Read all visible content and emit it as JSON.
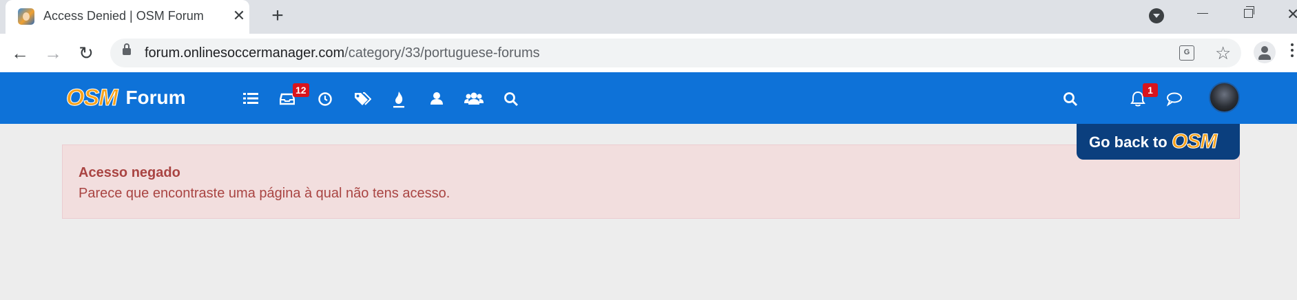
{
  "browser": {
    "tab": {
      "title": "Access Denied | OSM Forum",
      "close_glyph": "✕",
      "favicon": "osm-favicon-icon"
    },
    "new_tab_glyph": "+",
    "window_close_glyph": "✕",
    "address_bar": {
      "host": "forum.onlinesoccermanager.com",
      "path": "/category/33/portuguese-forums"
    },
    "nav": {
      "back_glyph": "←",
      "forward_glyph": "→",
      "reload_glyph": "↻"
    },
    "star_glyph": "☆",
    "translate_glyph": "G"
  },
  "forum": {
    "logo": {
      "brand": "OSM",
      "name": "Forum"
    },
    "nav_icons": [
      "list-icon",
      "inbox-icon",
      "clock-icon",
      "tags-icon",
      "fire-icon",
      "user-icon",
      "users-icon",
      "search-icon"
    ],
    "unread_badge": "12",
    "notification_badge": "1",
    "colors": {
      "header": "#0e72d8",
      "badge": "#d9141c",
      "alert_bg": "#f2dede",
      "alert_text": "#a94442",
      "go_back_bg": "#0b3f7e",
      "brand_orange": "#f7a21b"
    }
  },
  "go_back": {
    "label": "Go back to",
    "brand": "OSM"
  },
  "alert": {
    "title": "Acesso negado",
    "message": "Parece que encontraste uma página à qual não tens acesso."
  }
}
